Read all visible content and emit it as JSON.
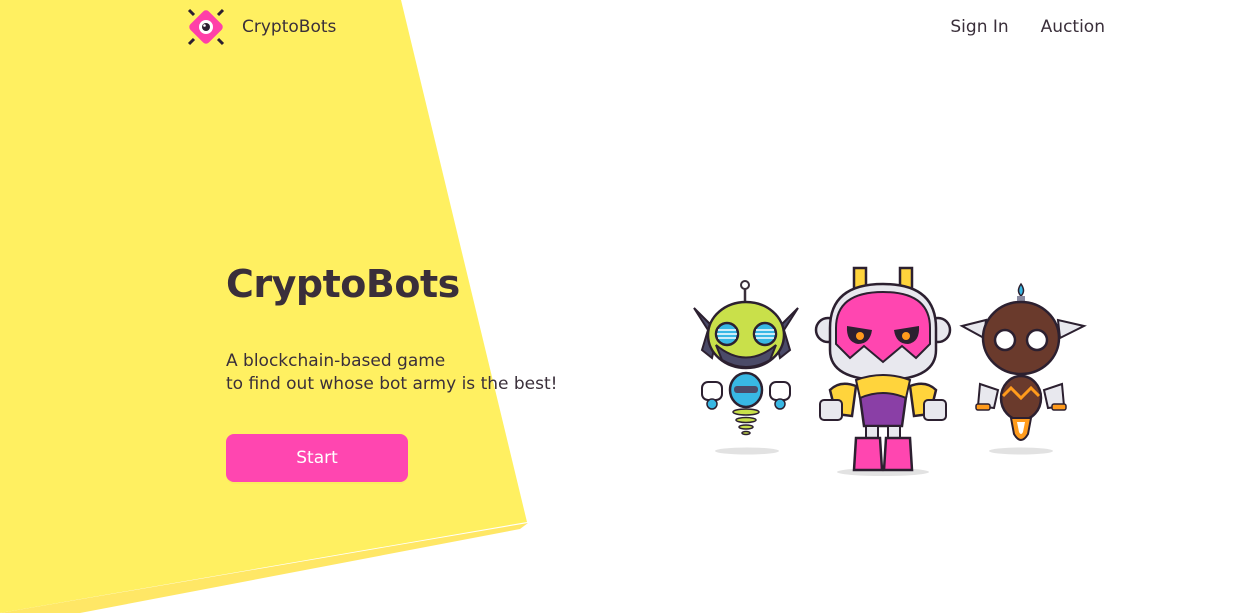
{
  "header": {
    "brand_name": "CryptoBots",
    "logo_icon": "eye-diamond-logo-icon",
    "nav": [
      {
        "label": "Sign In"
      },
      {
        "label": "Auction"
      }
    ]
  },
  "hero": {
    "title": "CryptoBots",
    "subtitle_lines": [
      "A blockchain-based game",
      "to find out whose bot army is the best!"
    ],
    "start_label": "Start"
  },
  "illustration": {
    "bots": [
      {
        "name": "green-robot-icon"
      },
      {
        "name": "pink-robot-icon"
      },
      {
        "name": "brown-robot-icon"
      }
    ]
  },
  "colors": {
    "accent_yellow": "#fff061",
    "accent_yellow_shade": "#ffe766",
    "brand_pink": "#ff46b0",
    "text_dark": "#3a2f3a"
  }
}
